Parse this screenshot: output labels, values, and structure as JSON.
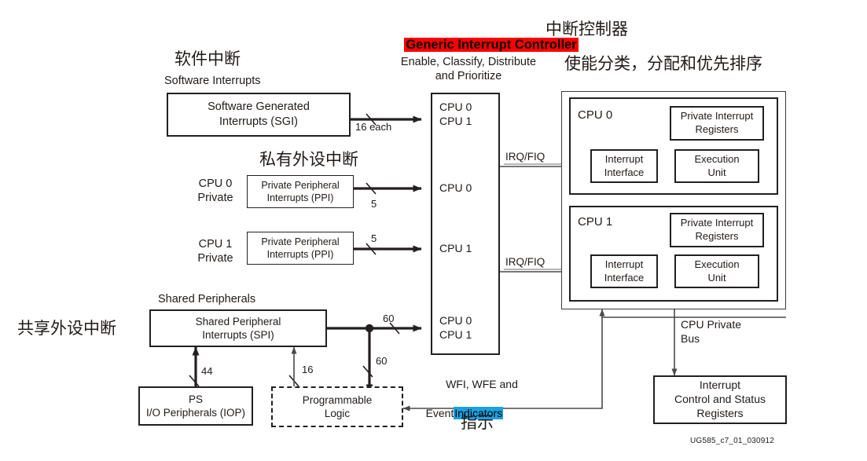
{
  "figure": {
    "id": "UG585_c7_01_030912",
    "title_en": "Generic Interrupt Controller",
    "title_sub_en": "Enable, Classify, Distribute\nand Prioritize",
    "title_cn": "中断控制器",
    "title_sub_cn": "使能分类，分配和优先排序"
  },
  "annotations": {
    "software_interrupts_cn": "软件中断",
    "software_interrupts_en": "Software Interrupts",
    "private_peripheral_cn": "私有外设中断",
    "shared_peripheral_cn": "共享外设中断",
    "shared_peripherals_en": "Shared Peripherals",
    "indication_cn": "指示"
  },
  "blocks": {
    "sgi": "Software Generated\nInterrupts (SGI)",
    "ppi0": "Private Peripheral\nInterrupts (PPI)",
    "ppi1": "Private Peripheral\nInterrupts (PPI)",
    "spi": "Shared Peripheral\nInterrupts (SPI)",
    "iop": "PS\nI/O Peripherals (IOP)",
    "pl": "Programmable\nLogic",
    "icsr": "Interrupt\nControl and Status\nRegisters",
    "gic_groups": [
      "CPU 0\nCPU 1",
      "CPU 0",
      "CPU 1",
      "CPU 0\nCPU 1"
    ]
  },
  "side_labels": {
    "cpu0_private": "CPU 0\nPrivate",
    "cpu1_private": "CPU 1\nPrivate"
  },
  "cpus": [
    {
      "name": "CPU 0",
      "private_registers": "Private Interrupt\nRegisters",
      "interrupt_interface": "Interrupt\nInterface",
      "execution_unit": "Execution\nUnit",
      "irq_label": "IRQ/FIQ"
    },
    {
      "name": "CPU 1",
      "private_registers": "Private Interrupt\nRegisters",
      "interrupt_interface": "Interrupt\nInterface",
      "execution_unit": "Execution\nUnit",
      "irq_label": "IRQ/FIQ"
    }
  ],
  "bus": {
    "cpu_private_bus": "CPU Private\nBus"
  },
  "signals": {
    "sgi_to_gic": "16 each",
    "ppi0_to_gic": "5",
    "ppi1_to_gic": "5",
    "spi_to_gic": "60",
    "spi_to_pl": "60",
    "iop_to_spi": "44",
    "pl_to_spi": "16",
    "wfi_wfe_line1": "WFI, WFE and",
    "wfi_wfe_line2_pre": "Event",
    "wfi_wfe_line2_hl": "Indicators"
  },
  "colors": {
    "highlight_red": "#ff0000",
    "highlight_blue": "#1ba1e2",
    "line": "#231f20",
    "text": "#201a17"
  }
}
